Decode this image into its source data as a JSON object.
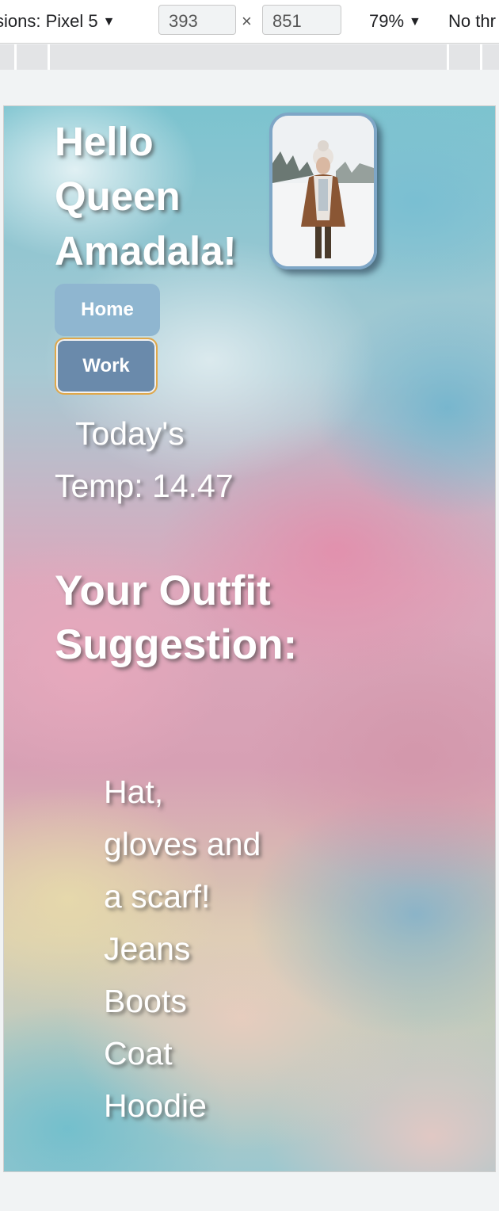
{
  "devtools": {
    "dimensions_label": "sions: Pixel 5",
    "width": "393",
    "times": "×",
    "height": "851",
    "zoom": "79%",
    "throttle": "No thr"
  },
  "page": {
    "greeting": "Hello\nQueen\nAmadala!",
    "nav": {
      "home_label": "Home",
      "work_label": "Work"
    },
    "temperature_text": "Today's Temp: 14.47",
    "outfit_heading": "Your Outfit Suggestion:",
    "outfit_items": [
      "Hat, gloves and a scarf!",
      "Jeans",
      "Boots",
      "Coat",
      "Hoodie"
    ]
  },
  "colors": {
    "home_button": "#8fb6d0",
    "work_button": "#6a8aab",
    "work_border": "#e0a84a",
    "profile_border": "#7ea6c6",
    "text": "#ffffff"
  }
}
